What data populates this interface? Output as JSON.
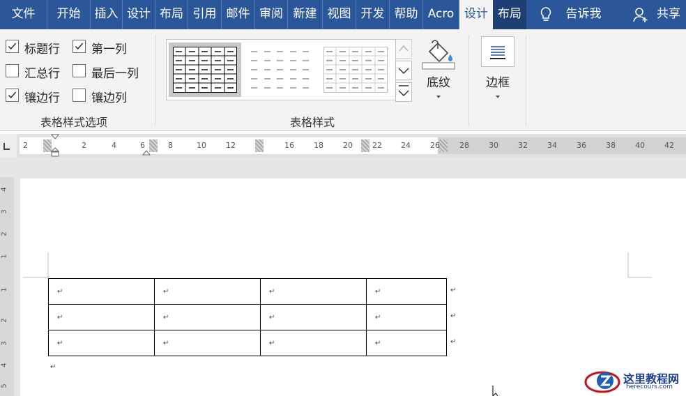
{
  "tabs": [
    {
      "label": "文件",
      "w": 0
    },
    {
      "label": "开始"
    },
    {
      "label": "插入"
    },
    {
      "label": "设计"
    },
    {
      "label": "布局"
    },
    {
      "label": "引用"
    },
    {
      "label": "邮件"
    },
    {
      "label": "审阅"
    },
    {
      "label": "新建"
    },
    {
      "label": "视图"
    },
    {
      "label": "开发"
    },
    {
      "label": "帮助"
    },
    {
      "label": "Acro"
    },
    {
      "label": "设计"
    },
    {
      "label": "布局"
    }
  ],
  "tell_me": "告诉我",
  "share": "共享",
  "options": {
    "header_row": "标题行",
    "first_column": "第一列",
    "total_row": "汇总行",
    "last_column": "最后一列",
    "banded_rows": "镶边行",
    "banded_columns": "镶边列",
    "group_label": "表格样式选项",
    "header_row_checked": true,
    "first_column_checked": true,
    "total_row_checked": false,
    "last_column_checked": false,
    "banded_rows_checked": true,
    "banded_columns_checked": false
  },
  "styles": {
    "group_label": "表格样式"
  },
  "shading": {
    "label": "底纹"
  },
  "borders": {
    "label": "边框"
  },
  "ruler": {
    "ticks": [
      "2",
      "2",
      "4",
      "6",
      "8",
      "10",
      "12",
      "16",
      "18",
      "20",
      "22",
      "24",
      "26",
      "28",
      "30",
      "32",
      "34",
      "36",
      "38",
      "40",
      "42"
    ]
  },
  "vruler": {
    "ticks": [
      "4",
      "3",
      "2",
      "1",
      "1",
      "2",
      "3",
      "4",
      "5"
    ]
  },
  "document": {
    "paragraph_mark": "↵",
    "rows": 3,
    "cols": 4
  },
  "watermark": {
    "title": "这里教程网",
    "url": "herecours.com"
  },
  "colors": {
    "accent": "#2b579a",
    "ribbon": "#f3f3f3"
  }
}
